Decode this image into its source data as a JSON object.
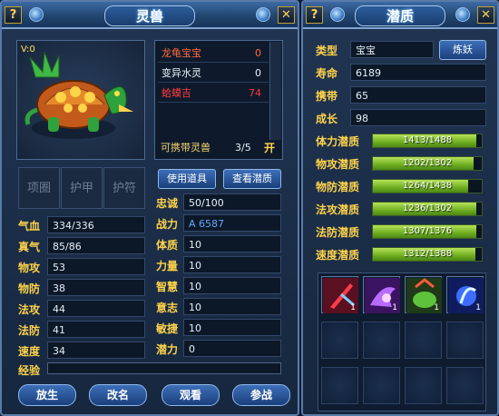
{
  "left_panel": {
    "title": "灵兽",
    "help_label": "?",
    "close_label": "✕",
    "pet_level": "V:0",
    "pet_list": [
      {
        "name": "龙龟宝宝",
        "value": "0",
        "color": "#ff6a3d"
      },
      {
        "name": "变异水灵",
        "value": "0",
        "color": "#e8eef7"
      },
      {
        "name": "蛤蟆吉",
        "value": "74",
        "color": "#ff3b3b"
      }
    ],
    "carry_label": "可携带灵兽",
    "carry_count": "3/5",
    "open_label": "开",
    "equip_slots": [
      "项圈",
      "护甲",
      "护符"
    ],
    "use_item_button": "使用道具",
    "view_potential_button": "查看潜质",
    "stats_left": [
      {
        "label": "气血",
        "value": "334/336"
      },
      {
        "label": "真气",
        "value": "85/86"
      },
      {
        "label": "物攻",
        "value": "53"
      },
      {
        "label": "物防",
        "value": "38"
      },
      {
        "label": "法攻",
        "value": "44"
      },
      {
        "label": "法防",
        "value": "41"
      },
      {
        "label": "速度",
        "value": "34"
      }
    ],
    "stats_right": [
      {
        "label": "忠诚",
        "value": "50/100"
      },
      {
        "label": "战力",
        "value": "A 6587"
      },
      {
        "label": "体质",
        "value": "10"
      },
      {
        "label": "力量",
        "value": "10"
      },
      {
        "label": "智慧",
        "value": "10"
      },
      {
        "label": "意志",
        "value": "10"
      },
      {
        "label": "敏捷",
        "value": "10"
      },
      {
        "label": "潜力",
        "value": "0"
      }
    ],
    "exp_label": "经验",
    "exp_fraction": 0,
    "buttons": [
      "放生",
      "改名",
      "观看",
      "参战"
    ]
  },
  "right_panel": {
    "title": "潜质",
    "help_label": "?",
    "close_label": "✕",
    "type_label": "类型",
    "type_value": "宝宝",
    "refine_button": "炼妖",
    "life_label": "寿命",
    "life_value": "6189",
    "carry_label": "携带",
    "carry_value": "65",
    "growth_label": "成长",
    "growth_value": "98",
    "potentials": [
      {
        "label": "体力潜质",
        "text": "1413/1488",
        "fraction": 0.9496
      },
      {
        "label": "物攻潜质",
        "text": "1202/1302",
        "fraction": 0.9232
      },
      {
        "label": "物防潜质",
        "text": "1264/1438",
        "fraction": 0.879
      },
      {
        "label": "法攻潜质",
        "text": "1236/1302",
        "fraction": 0.9493
      },
      {
        "label": "法防潜质",
        "text": "1307/1376",
        "fraction": 0.9499
      },
      {
        "label": "速度潜质",
        "text": "1312/1388",
        "fraction": 0.9452
      }
    ],
    "skills": [
      {
        "icon": "red-blade-skill-icon",
        "count": "1"
      },
      {
        "icon": "purple-claw-skill-icon",
        "count": "1"
      },
      {
        "icon": "green-beast-skill-icon",
        "count": "1"
      },
      {
        "icon": "blue-wisp-skill-icon",
        "count": "1"
      }
    ]
  }
}
